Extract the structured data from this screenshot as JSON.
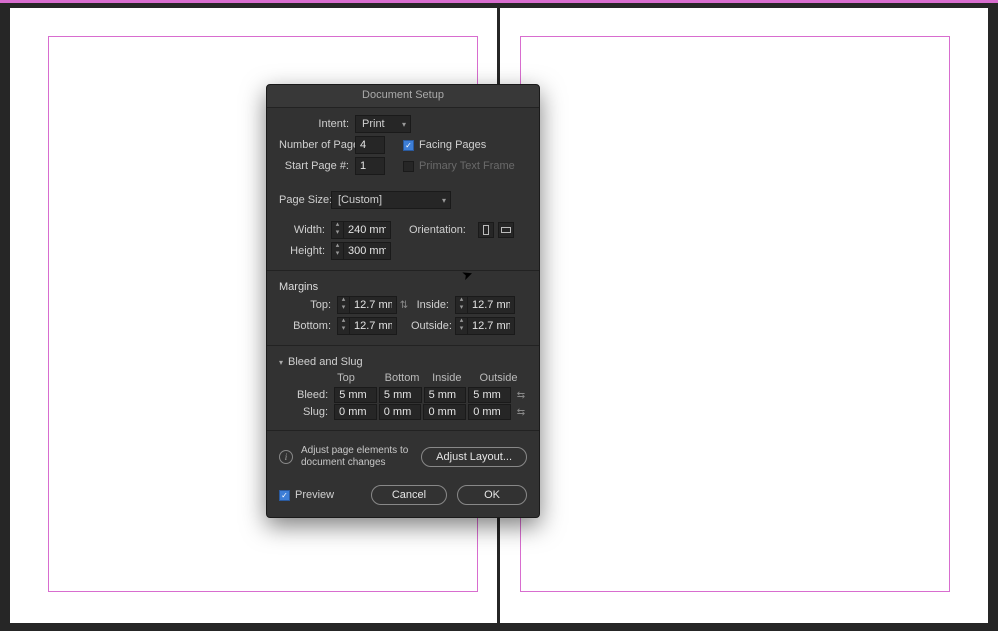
{
  "dialog": {
    "title": "Document Setup",
    "intent": {
      "label": "Intent:",
      "value": "Print"
    },
    "num_pages": {
      "label": "Number of Pages:",
      "value": "4"
    },
    "start_page": {
      "label": "Start Page #:",
      "value": "1"
    },
    "facing_pages": {
      "label": "Facing Pages",
      "checked": true
    },
    "primary_text_frame": {
      "label": "Primary Text Frame",
      "checked": false,
      "disabled": true
    },
    "page_size": {
      "label": "Page Size:",
      "value": "[Custom]"
    },
    "width": {
      "label": "Width:",
      "value": "240 mm"
    },
    "height": {
      "label": "Height:",
      "value": "300 mm"
    },
    "orientation": {
      "label": "Orientation:"
    },
    "margins": {
      "title": "Margins",
      "top": {
        "label": "Top:",
        "value": "12.7 mm"
      },
      "bottom": {
        "label": "Bottom:",
        "value": "12.7 mm"
      },
      "inside": {
        "label": "Inside:",
        "value": "12.7 mm"
      },
      "outside": {
        "label": "Outside:",
        "value": "12.7 mm"
      }
    },
    "bleed_slug": {
      "title": "Bleed and Slug",
      "cols": [
        "Top",
        "Bottom",
        "Inside",
        "Outside"
      ],
      "bleed": {
        "label": "Bleed:",
        "values": [
          "5 mm",
          "5 mm",
          "5 mm",
          "5 mm"
        ]
      },
      "slug": {
        "label": "Slug:",
        "values": [
          "0 mm",
          "0 mm",
          "0 mm",
          "0 mm"
        ]
      }
    },
    "adjust": {
      "text": "Adjust page elements to document changes",
      "button": "Adjust Layout..."
    },
    "preview": {
      "label": "Preview",
      "checked": true
    },
    "cancel": "Cancel",
    "ok": "OK"
  }
}
